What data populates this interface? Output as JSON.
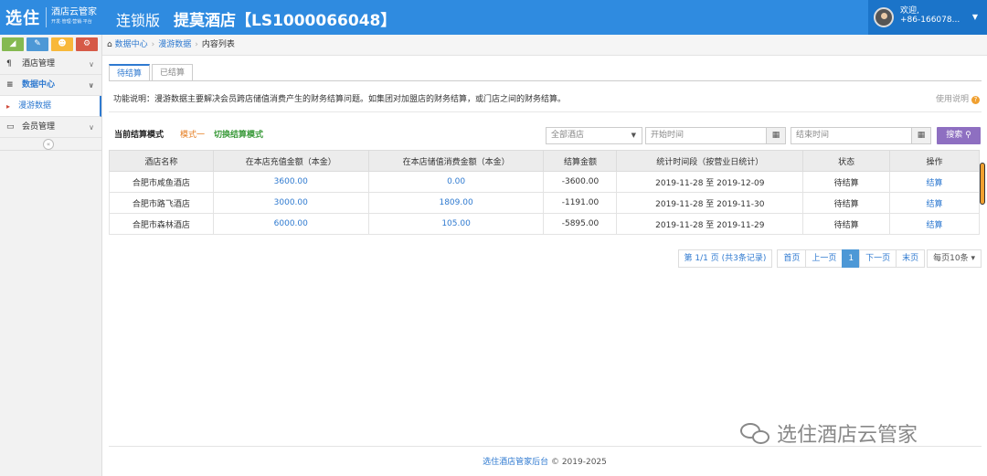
{
  "header": {
    "logo": "选住",
    "logo_sub": "酒店云管家",
    "logo_tag": "开发·管理·营销·平台",
    "edition": "连锁版",
    "hotel": "提莫酒店【LS1000066048】",
    "welcome": "欢迎,",
    "phone": "+86-166078..."
  },
  "sidebar": {
    "items": [
      {
        "label": "酒店管理",
        "icon": "fork-knife-icon"
      },
      {
        "label": "数据中心",
        "icon": "database-icon"
      },
      {
        "label": "会员管理",
        "icon": "id-card-icon"
      }
    ],
    "subitem": "漫游数据",
    "collapse": "«"
  },
  "breadcrumb": [
    "数据中心",
    "漫游数据",
    "内容列表"
  ],
  "tabs": [
    "待结算",
    "已结算"
  ],
  "description": "功能说明：漫游数据主要解决会员跨店储值消费产生的财务结算问题。如集团对加盟店的财务结算，或门店之间的财务结算。",
  "help_label": "使用说明",
  "filter": {
    "mode_label": "当前结算模式",
    "mode_value": "模式一",
    "switch_label": "切换结算模式",
    "hotel_select": "全部酒店",
    "start_placeholder": "开始时间",
    "end_placeholder": "结束时间",
    "search_label": "搜索"
  },
  "table": {
    "headers": [
      "酒店名称",
      "在本店充值金额（本金）",
      "在本店储值消费金额（本金）",
      "结算金额",
      "统计时间段（按营业日统计）",
      "状态",
      "操作"
    ],
    "rows": [
      {
        "name": "合肥市咸鱼酒店",
        "recharge": "3600.00",
        "consume": "0.00",
        "amount": "-3600.00",
        "period": "2019-11-28 至 2019-12-09",
        "status": "待结算",
        "action": "结算"
      },
      {
        "name": "合肥市路飞酒店",
        "recharge": "3000.00",
        "consume": "1809.00",
        "amount": "-1191.00",
        "period": "2019-11-28 至 2019-11-30",
        "status": "待结算",
        "action": "结算"
      },
      {
        "name": "合肥市森林酒店",
        "recharge": "6000.00",
        "consume": "105.00",
        "amount": "-5895.00",
        "period": "2019-11-28 至 2019-11-29",
        "status": "待结算",
        "action": "结算"
      }
    ]
  },
  "pager": {
    "info": "第 1/1 页 (共3条记录)",
    "first": "首页",
    "prev": "上一页",
    "current": "1",
    "next": "下一页",
    "last": "末页",
    "size": "每页10条"
  },
  "footer": {
    "brand": "选住酒店管家后台",
    "copyright": " © 2019-2025"
  },
  "watermark": "选住酒店云管家"
}
